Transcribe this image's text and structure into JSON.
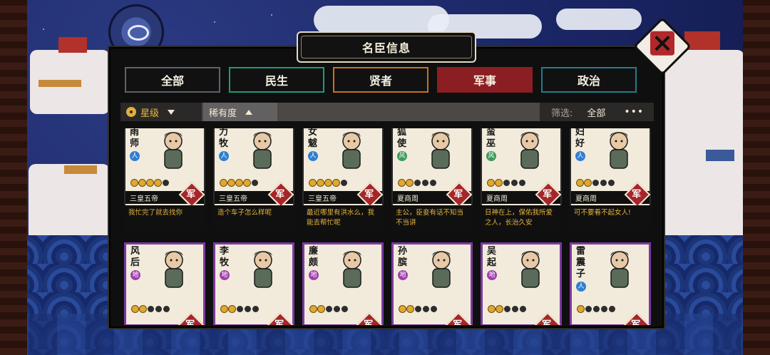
{
  "title": "名臣信息",
  "tabs": [
    {
      "label": "全部",
      "color": "#5d6369"
    },
    {
      "label": "民生",
      "color": "#1e9a7a"
    },
    {
      "label": "贤者",
      "color": "#c6731f"
    },
    {
      "label": "军事",
      "color": "#8b1e22",
      "active": true
    },
    {
      "label": "政治",
      "color": "#1f7e8a"
    }
  ],
  "sort": {
    "star_label": "星级",
    "rarity_label": "稀有度"
  },
  "filter": {
    "label": "筛选:",
    "value": "全部",
    "more": "•••"
  },
  "category_icon": "军",
  "cards_row1": [
    {
      "name": "雨师",
      "badge": "人",
      "badge_color": "#2f7fd1",
      "stars": 5,
      "era": "三皇五帝",
      "quote": "我忙完了就去找你"
    },
    {
      "name": "力牧",
      "badge": "人",
      "badge_color": "#2f7fd1",
      "stars": 5,
      "era": "三皇五帝",
      "quote": "造个车子怎么样呢"
    },
    {
      "name": "女魃",
      "badge": "人",
      "badge_color": "#2f7fd1",
      "stars": 5,
      "era": "三皇五帝",
      "quote": "最近哪里有洪水么，我能去帮忙呢"
    },
    {
      "name": "狐使",
      "badge": "风",
      "badge_color": "#3c9a5a",
      "stars": 5,
      "era": "夏商周",
      "quote": "主公，臣妾有话不知当不当讲"
    },
    {
      "name": "蛮巫",
      "badge": "风",
      "badge_color": "#3c9a5a",
      "stars": 5,
      "era": "夏商周",
      "quote": "日神在上，保佑我所爱之人，长治久安"
    },
    {
      "name": "妇好",
      "badge": "人",
      "badge_color": "#2f7fd1",
      "stars": 5,
      "era": "夏商周",
      "quote": "可不要看不起女人!"
    }
  ],
  "cards_row2": [
    {
      "name": "风后",
      "badge": "地",
      "badge_color": "#a13fae",
      "stars": 5
    },
    {
      "name": "李牧",
      "badge": "地",
      "badge_color": "#a13fae",
      "stars": 5
    },
    {
      "name": "廉颇",
      "badge": "地",
      "badge_color": "#a13fae",
      "stars": 5
    },
    {
      "name": "孙膑",
      "badge": "地",
      "badge_color": "#a13fae",
      "stars": 5
    },
    {
      "name": "吴起",
      "badge": "地",
      "badge_color": "#a13fae",
      "stars": 5
    },
    {
      "name": "雷震子",
      "badge": "人",
      "badge_color": "#2f7fd1",
      "stars": 5
    }
  ],
  "stars_lit_row1": [
    4,
    4,
    4,
    2,
    2,
    2
  ],
  "stars_lit_row2": [
    2,
    2,
    2,
    2,
    2,
    1
  ]
}
